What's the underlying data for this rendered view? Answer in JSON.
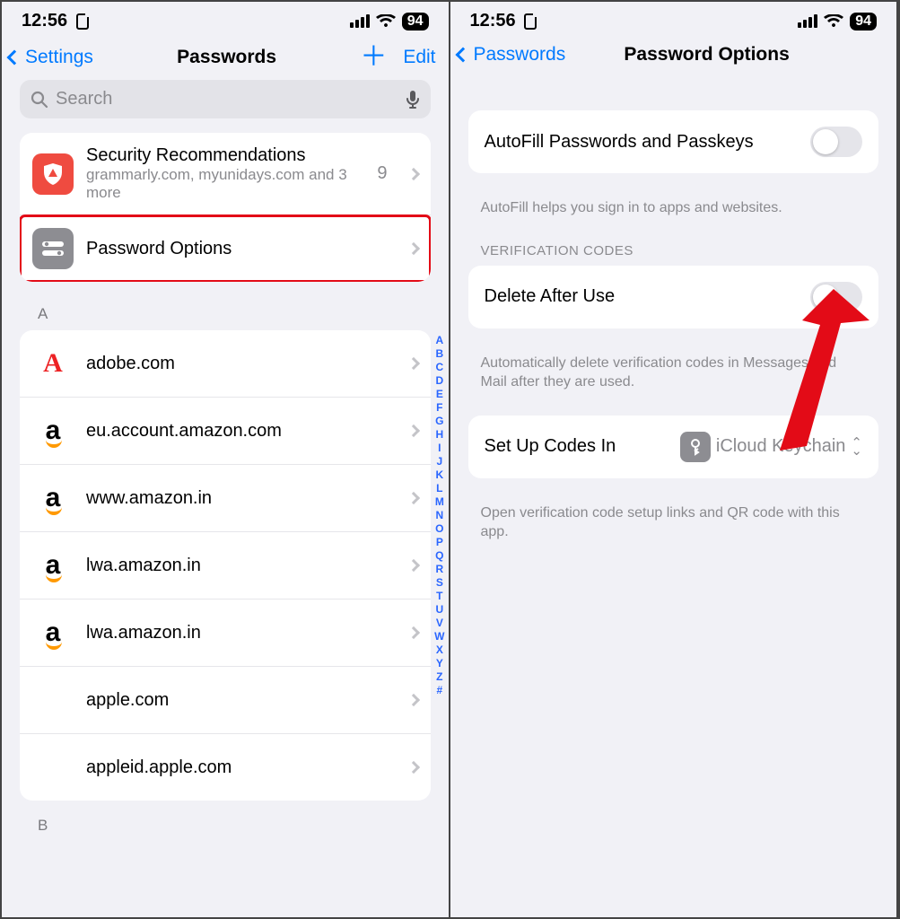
{
  "status": {
    "time": "12:56",
    "battery": "94"
  },
  "left": {
    "nav": {
      "back": "Settings",
      "title": "Passwords",
      "edit": "Edit"
    },
    "search_placeholder": "Search",
    "security": {
      "title": "Security Recommendations",
      "sub": "grammarly.com, myunidays.com and 3 more",
      "count": "9"
    },
    "password_options": "Password Options",
    "section_a": "A",
    "section_b": "B",
    "items": [
      {
        "site": "adobe.com",
        "icon": "adobe"
      },
      {
        "site": "eu.account.amazon.com",
        "icon": "amazon"
      },
      {
        "site": "www.amazon.in",
        "icon": "amazon"
      },
      {
        "site": "lwa.amazon.in",
        "icon": "amazon"
      },
      {
        "site": "lwa.amazon.in",
        "icon": "amazon"
      },
      {
        "site": "apple.com",
        "icon": "apple"
      },
      {
        "site": "appleid.apple.com",
        "icon": "apple"
      }
    ],
    "index": [
      "A",
      "B",
      "C",
      "D",
      "E",
      "F",
      "G",
      "H",
      "I",
      "J",
      "K",
      "L",
      "M",
      "N",
      "O",
      "P",
      "Q",
      "R",
      "S",
      "T",
      "U",
      "V",
      "W",
      "X",
      "Y",
      "Z",
      "#"
    ]
  },
  "right": {
    "nav": {
      "back": "Passwords",
      "title": "Password Options"
    },
    "autofill": {
      "label": "AutoFill Passwords and Passkeys",
      "footer": "AutoFill helps you sign in to apps and websites."
    },
    "verification": {
      "header": "VERIFICATION CODES",
      "label": "Delete After Use",
      "footer": "Automatically delete verification codes in Messages and Mail after they are used."
    },
    "setup": {
      "label": "Set Up Codes In",
      "value": "iCloud Keychain",
      "footer": "Open verification code setup links and QR code with this app."
    }
  }
}
